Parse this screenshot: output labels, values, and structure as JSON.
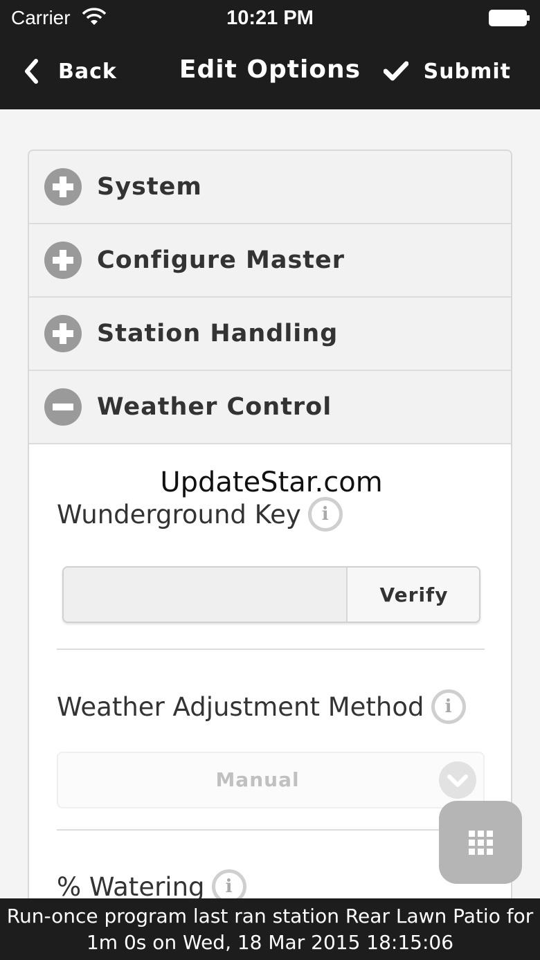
{
  "status_bar": {
    "carrier": "Carrier",
    "time": "10:21 PM"
  },
  "header": {
    "back_label": "Back",
    "title": "Edit Options",
    "submit_label": "Submit"
  },
  "accordion": {
    "sections": [
      {
        "label": "System",
        "expanded": false
      },
      {
        "label": "Configure Master",
        "expanded": false
      },
      {
        "label": "Station Handling",
        "expanded": false
      },
      {
        "label": "Weather Control",
        "expanded": true
      }
    ]
  },
  "weather_control": {
    "watermark": "UpdateStar.com",
    "wunderground_label": "Wunderground Key",
    "wunderground_value": "",
    "verify_label": "Verify",
    "adjustment_label": "Weather Adjustment Method",
    "adjustment_value": "Manual",
    "watering_label": "% Watering",
    "info_glyph": "i"
  },
  "footer": {
    "line1": "Run-once program last ran station Rear Lawn Patio for",
    "line2": "1m 0s on Wed, 18 Mar 2015 18:15:06"
  },
  "colors": {
    "header_bg": "#1d1d1d",
    "page_bg": "#f4f4f4",
    "accordion_head_bg": "#f2f2f2",
    "icon_gray": "#9a9a9a"
  }
}
